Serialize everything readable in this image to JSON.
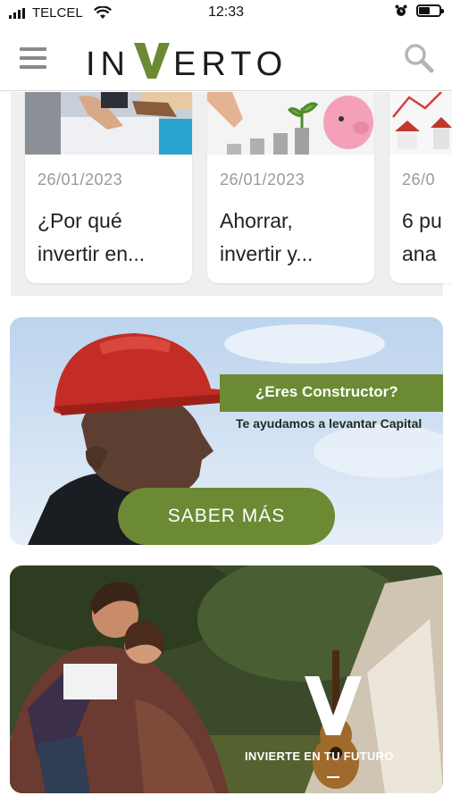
{
  "status_bar": {
    "carrier": "TELCEL",
    "time": "12:33",
    "battery_level": 0.55
  },
  "header": {
    "logo_text": "INVERTO",
    "menu_icon": "hamburger-menu-icon",
    "search_icon": "search-icon",
    "brand_color": "#6c8a34"
  },
  "articles": [
    {
      "date": "26/01/2023",
      "title": "¿Por qué\ninvertir en..."
    },
    {
      "date": "26/01/2023",
      "title": "Ahorrar,\ninvertir y..."
    },
    {
      "date": "26/0",
      "title": "6 pu\nana"
    }
  ],
  "constructor_banner": {
    "question": "¿Eres Constructor?",
    "text": "Te ayudamos a levantar Capital",
    "button_label": "SABER MÁS"
  },
  "future_banner": {
    "label": "INVIERTE EN TU FUTURO"
  }
}
